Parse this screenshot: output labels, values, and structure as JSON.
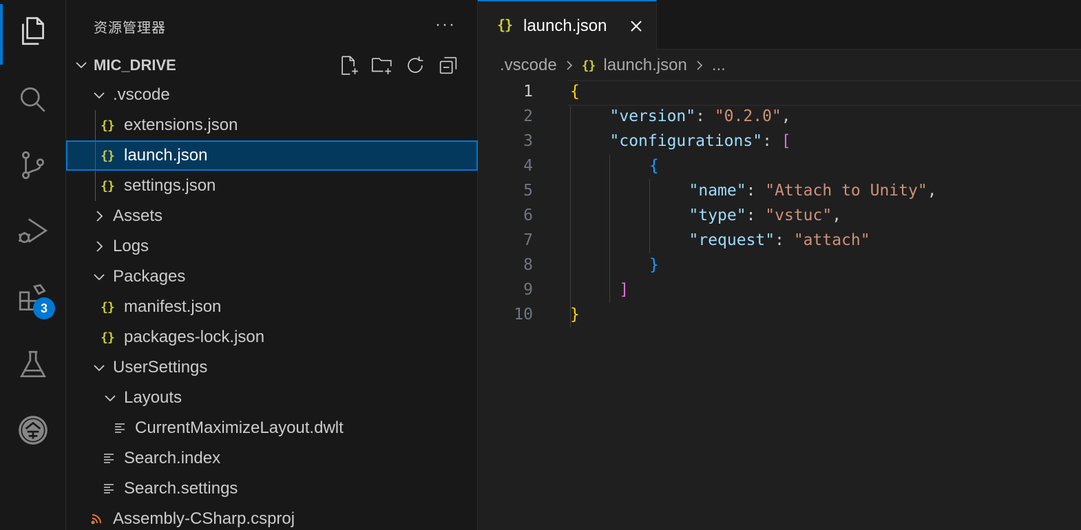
{
  "sidebar": {
    "title": "资源管理器",
    "more": "···",
    "project": "MIC_DRIVE",
    "tree": [
      {
        "label": ".vscode",
        "type": "folder-open",
        "depth": 1
      },
      {
        "label": "extensions.json",
        "type": "json",
        "depth": 2
      },
      {
        "label": "launch.json",
        "type": "json",
        "depth": 2,
        "selected": true
      },
      {
        "label": "settings.json",
        "type": "json",
        "depth": 2
      },
      {
        "label": "Assets",
        "type": "folder-closed",
        "depth": 1
      },
      {
        "label": "Logs",
        "type": "folder-closed",
        "depth": 1
      },
      {
        "label": "Packages",
        "type": "folder-open",
        "depth": 1
      },
      {
        "label": "manifest.json",
        "type": "json",
        "depth": 2
      },
      {
        "label": "packages-lock.json",
        "type": "json",
        "depth": 2
      },
      {
        "label": "UserSettings",
        "type": "folder-open",
        "depth": 1
      },
      {
        "label": "Layouts",
        "type": "folder-open",
        "depth": 2
      },
      {
        "label": "CurrentMaximizeLayout.dwlt",
        "type": "text",
        "depth": 3
      },
      {
        "label": "Search.index",
        "type": "text",
        "depth": 2
      },
      {
        "label": "Search.settings",
        "type": "text",
        "depth": 2
      },
      {
        "label": "Assembly-CSharp.csproj",
        "type": "rss",
        "depth": 1
      }
    ]
  },
  "activity": {
    "extensions_badge": "3",
    "icons": [
      "files-icon",
      "search-icon",
      "source-control-icon",
      "run-debug-icon",
      "extensions-icon",
      "testing-icon",
      "account-seal-icon"
    ]
  },
  "editor": {
    "tab_label": "launch.json",
    "json_glyph": "{}",
    "breadcrumb": {
      "folder": ".vscode",
      "file": "launch.json",
      "more": "..."
    },
    "lines": [
      {
        "n": "1",
        "indent": 0,
        "tokens": [
          [
            "b1",
            "{"
          ]
        ]
      },
      {
        "n": "2",
        "indent": 1,
        "tokens": [
          [
            "k",
            "\"version\""
          ],
          [
            "p",
            ": "
          ],
          [
            "s",
            "\"0.2.0\""
          ],
          [
            "p",
            ","
          ]
        ]
      },
      {
        "n": "3",
        "indent": 1,
        "tokens": [
          [
            "k",
            "\"configurations\""
          ],
          [
            "p",
            ": "
          ],
          [
            "b2",
            "["
          ]
        ]
      },
      {
        "n": "4",
        "indent": 2,
        "tokens": [
          [
            "b3",
            "{"
          ]
        ]
      },
      {
        "n": "5",
        "indent": 3,
        "tokens": [
          [
            "k",
            "\"name\""
          ],
          [
            "p",
            ": "
          ],
          [
            "s",
            "\"Attach to Unity\""
          ],
          [
            "p",
            ","
          ]
        ]
      },
      {
        "n": "6",
        "indent": 3,
        "tokens": [
          [
            "k",
            "\"type\""
          ],
          [
            "p",
            ": "
          ],
          [
            "s",
            "\"vstuc\""
          ],
          [
            "p",
            ","
          ]
        ]
      },
      {
        "n": "7",
        "indent": 3,
        "tokens": [
          [
            "k",
            "\"request\""
          ],
          [
            "p",
            ": "
          ],
          [
            "s",
            "\"attach\""
          ]
        ]
      },
      {
        "n": "8",
        "indent": 2,
        "tokens": [
          [
            "b3",
            "}"
          ]
        ]
      },
      {
        "n": "9",
        "indent": 1,
        "tokens": [
          [
            "b2",
            " ]"
          ]
        ]
      },
      {
        "n": "10",
        "indent": 0,
        "tokens": [
          [
            "b1",
            "}"
          ]
        ]
      }
    ]
  }
}
